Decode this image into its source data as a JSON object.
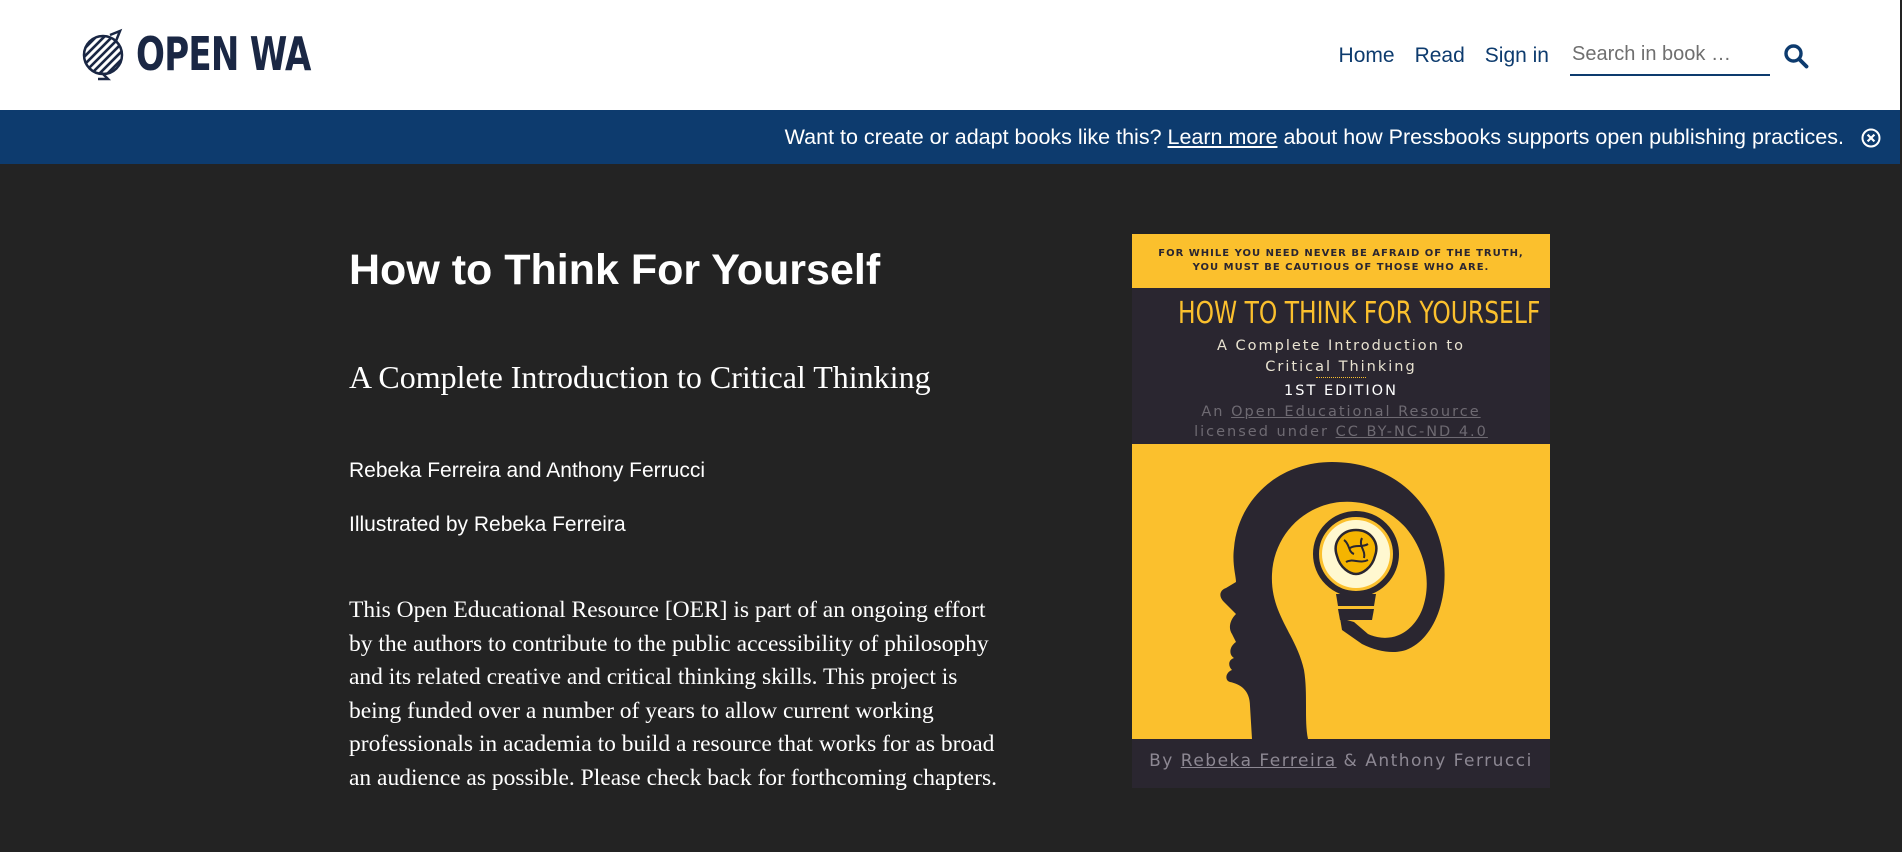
{
  "header": {
    "logo_text": "OPEN WA",
    "nav": {
      "home": "Home",
      "read": "Read",
      "sign_in": "Sign in"
    },
    "search": {
      "placeholder": "Search in book …"
    }
  },
  "banner": {
    "text_before": "Want to create or adapt books like this?",
    "link": "Learn more",
    "text_after": "about how Pressbooks supports open publishing practices."
  },
  "book": {
    "title": "How to Think For Yourself",
    "subtitle": "A Complete Introduction to Critical Thinking",
    "authors": "Rebeka Ferreira and Anthony Ferrucci",
    "illustrator": "Illustrated by Rebeka Ferreira",
    "description": "This Open Educational Resource [OER] is part of an ongoing effort by the authors to contribute to the public accessibility of philosophy and its related creative and critical thinking skills. This project is being funded over a number of years to allow current working professionals in academia to build a resource that works for as broad an audience as possible. Please check back for forthcoming chapters."
  },
  "cover": {
    "quote_line1": "FOR WHILE YOU NEED NEVER BE AFRAID OF THE TRUTH,",
    "quote_line2": "YOU MUST BE CAUTIOUS OF THOSE WHO ARE.",
    "title": "HOW TO THINK FOR YOURSELF",
    "subtitle_line1": "A Complete Introduction to",
    "subtitle_line2": "Critical Thinking",
    "edition": "1ST EDITION",
    "license_prefix": "An",
    "license_oer": "Open Educational Resource",
    "license_mid": "licensed under",
    "license_cc": "CC BY-NC-ND 4.0",
    "by": "By",
    "author1": "Rebeka Ferreira",
    "amp": "&",
    "author2": "Anthony Ferrucci"
  },
  "colors": {
    "header_bg": "#ffffff",
    "brand_navy": "#0d3b6e",
    "page_bg": "#232323",
    "cover_yellow": "#fbc02d",
    "cover_dark": "#2a2630"
  },
  "icons": {
    "logo": "globe-logo-icon",
    "search": "search-icon",
    "close": "close-circle-icon"
  }
}
